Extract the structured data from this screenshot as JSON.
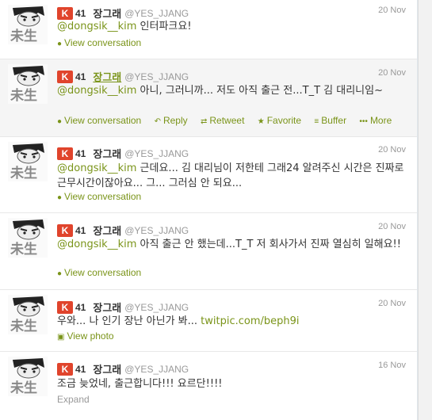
{
  "tweets": [
    {
      "klout_icon": "K",
      "klout_score": "41",
      "fullname": "장그래",
      "handle": "@YES_JJANG",
      "time": "20 Nov",
      "mention": "@dongsik__kim",
      "body": " 인터파크요!",
      "action": "View conversation"
    },
    {
      "klout_icon": "K",
      "klout_score": "41",
      "fullname": "장그래",
      "handle": "@YES_JJANG",
      "time": "20 Nov",
      "mention": "@dongsik__kim",
      "body": " 아니, 그러니까... 저도 아직 출근 전...T_T 김 대리니임~",
      "action": "View conversation",
      "reply": "Reply",
      "retweet": "Retweet",
      "favorite": "Favorite",
      "buffer": "Buffer",
      "more": "More"
    },
    {
      "klout_icon": "K",
      "klout_score": "41",
      "fullname": "장그래",
      "handle": "@YES_JJANG",
      "time": "20 Nov",
      "mention": "@dongsik__kim",
      "body": " 근데요... 김 대리님이 저한테 그래24 알려주신 시간은 진짜로 근무시간이잖아요... 그... 그러심 안 되요...",
      "action": "View conversation"
    },
    {
      "klout_icon": "K",
      "klout_score": "41",
      "fullname": "장그래",
      "handle": "@YES_JJANG",
      "time": "20 Nov",
      "mention": "@dongsik__kim",
      "body": " 아직 출근 안 했는데...T_T 저 회사가서 진짜 열심히 일해요!!",
      "action": "View conversation"
    },
    {
      "klout_icon": "K",
      "klout_score": "41",
      "fullname": "장그래",
      "handle": "@YES_JJANG",
      "time": "20 Nov",
      "body": "우와... 나 인기 장난 아닌가 봐... ",
      "link": "twitpic.com/beph9i",
      "action": "View photo"
    },
    {
      "klout_icon": "K",
      "klout_score": "41",
      "fullname": "장그래",
      "handle": "@YES_JJANG",
      "time": "16 Nov",
      "body": "조금 늦었네, 출근합니다!!! 요르단!!!!",
      "action": "Expand"
    }
  ],
  "avatar_glyphs": "未生",
  "colors": {
    "accent": "#7a9419",
    "klout": "#e0442c",
    "muted": "#999999",
    "hover_row": "#f5f5f5"
  },
  "icons": [
    "speech-bubble-icon",
    "reply-arrow-icon",
    "retweet-icon",
    "star-icon",
    "buffer-stack-icon",
    "more-dots-icon",
    "photo-icon",
    "klout-icon"
  ]
}
